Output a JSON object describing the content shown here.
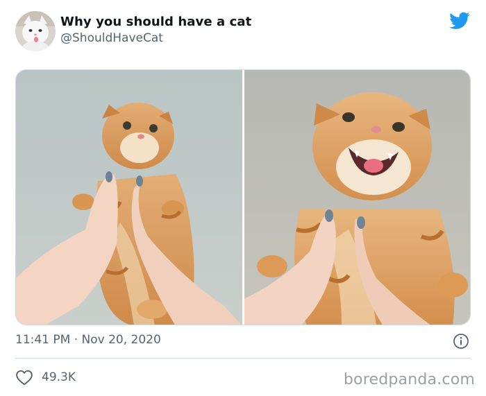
{
  "tweet": {
    "display_name": "Why you should have a cat",
    "handle": "@ShouldHaveCat",
    "time": "11:41 PM · Nov 20, 2020",
    "likes": "49.3K"
  },
  "media": {
    "images": [
      {
        "subject": "orange tabby kitten held up, calm"
      },
      {
        "subject": "orange tabby kitten held up, mouth open"
      }
    ]
  },
  "icons": {
    "brand": "twitter-bird",
    "info": "info-circle",
    "like": "heart-outline"
  },
  "colors": {
    "twitter_blue": "#1d9bf0",
    "muted_text": "#536471",
    "divider": "#cfd9de",
    "cat_orange": "#d9964f"
  },
  "watermark": "boredpanda.com"
}
